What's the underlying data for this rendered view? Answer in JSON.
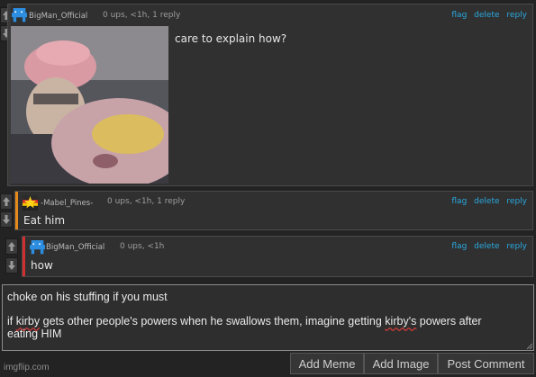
{
  "comments": [
    {
      "username": "BigMan_Official",
      "meta": "0 ups, <1h, 1 reply",
      "actions": [
        "flag",
        "delete",
        "reply"
      ],
      "text": "care to explain how?",
      "accent": "#3a3a3a",
      "icon": "blue-pixel-creature-icon"
    },
    {
      "username": "-Mabel_Pines-",
      "meta": "0 ups, <1h, 1 reply",
      "actions": [
        "flag",
        "delete",
        "reply"
      ],
      "text": "Eat him",
      "accent": "#e58a1a",
      "icon": "mabel-star-flag-icon"
    },
    {
      "username": "BigMan_Official",
      "meta": "0 ups, <1h",
      "actions": [
        "flag",
        "delete",
        "reply"
      ],
      "text": "how",
      "accent": "#d22f2f",
      "icon": "blue-pixel-creature-icon"
    }
  ],
  "reply_box": {
    "line1": "choke on his stuffing if you must",
    "line2_parts": [
      "if ",
      "kirby",
      " gets other people's powers when he swallows them, imagine getting ",
      "kirby's",
      " powers after"
    ],
    "line3": "eating HIM"
  },
  "buttons": {
    "add_meme": "Add Meme",
    "add_image": "Add Image",
    "post_comment": "Post Comment"
  },
  "watermark": "imgflip.com",
  "colors": {
    "link": "#2aa9e0",
    "background": "#232323",
    "panel": "#303030"
  }
}
